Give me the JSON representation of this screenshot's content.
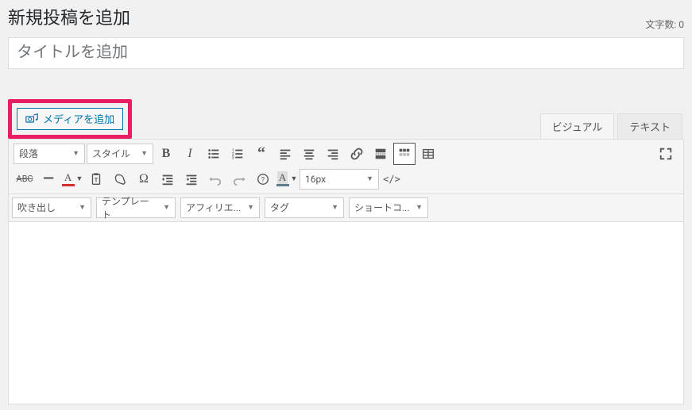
{
  "header": {
    "title": "新規投稿を追加",
    "charcount_label": "文字数: 0"
  },
  "title_field": {
    "placeholder": "タイトルを追加",
    "value": ""
  },
  "media_button": {
    "label": "メディアを追加"
  },
  "editor_tabs": {
    "visual": "ビジュアル",
    "text": "テキスト",
    "active": "visual"
  },
  "toolbar_row1": {
    "paragraph_dd": "段落",
    "style_dd": "スタイル",
    "fontsize_dd": "16px"
  },
  "dropdowns_row3": {
    "balloon": "吹き出し",
    "template": "テンプレート",
    "affiliate": "アフィリエ...",
    "tag": "タグ",
    "shortcode": "ショートコ..."
  },
  "colors": {
    "text_color": "#d32f2f",
    "bg_color": "#607d8b"
  }
}
